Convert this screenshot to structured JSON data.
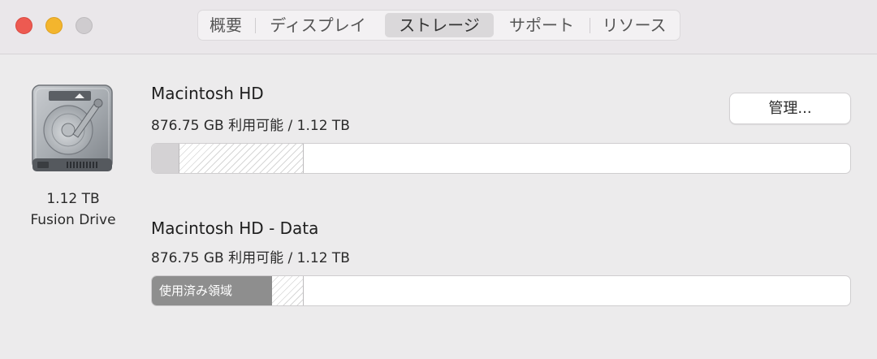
{
  "window": {
    "controls": [
      "close",
      "minimize",
      "zoom"
    ]
  },
  "tabs": [
    {
      "label": "概要",
      "selected": false
    },
    {
      "label": "ディスプレイ",
      "selected": false
    },
    {
      "label": "ストレージ",
      "selected": true
    },
    {
      "label": "サポート",
      "selected": false
    },
    {
      "label": "リソース",
      "selected": false
    }
  ],
  "drive": {
    "icon": "hard-drive-icon",
    "size": "1.12 TB",
    "type": "Fusion Drive"
  },
  "volumes": [
    {
      "name": "Macintosh HD",
      "available": "876.75 GB 利用可能 / 1.12 TB",
      "manage_label": "管理..."
    },
    {
      "name": "Macintosh HD - Data",
      "available": "876.75 GB 利用可能 / 1.12 TB",
      "used_label": "使用済み領域"
    }
  ],
  "colors": {
    "close": "#ed5a51",
    "minimize": "#f3b52d",
    "zoom": "#cfcccf",
    "used": "#8e8e8e"
  }
}
